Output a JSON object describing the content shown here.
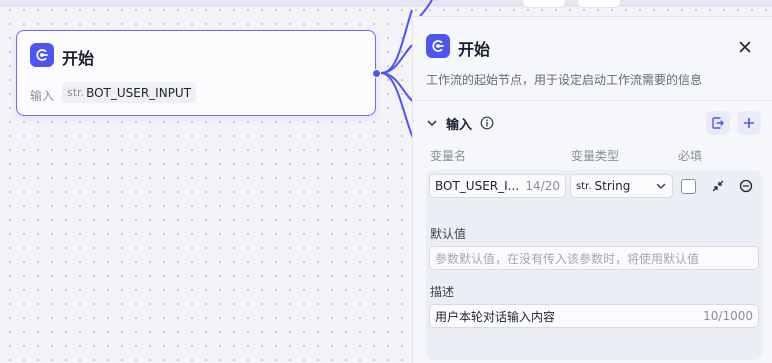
{
  "colors": {
    "accent": "#4f55f1",
    "node_border": "#6f6bf0",
    "panel_bg": "#f6f7fb",
    "card_bg": "#eceef6"
  },
  "start_node": {
    "icon": "start-icon",
    "title": "开始",
    "input_label": "输入",
    "variable": {
      "type_prefix": "str.",
      "name": "BOT_USER_INPUT"
    }
  },
  "panel": {
    "icon": "start-icon",
    "title": "开始",
    "description": "工作流的起始节点，用于设定启动工作流需要的信息",
    "section": {
      "title": "输入",
      "info_icon": "info-icon",
      "import_icon": "import-icon",
      "add_icon": "plus-icon"
    },
    "columns": {
      "name": "变量名",
      "type": "变量类型",
      "required": "必填"
    },
    "variable_row": {
      "name_value": "BOT_USER_I...",
      "name_count": "14/20",
      "type_prefix": "str.",
      "type_value": "String",
      "required_checked": false,
      "default_label": "默认值",
      "default_placeholder": "参数默认值，在没有传入该参数时，将使用默认值",
      "desc_label": "描述",
      "desc_value": "用户本轮对话输入内容",
      "desc_count": "10/1000"
    }
  }
}
